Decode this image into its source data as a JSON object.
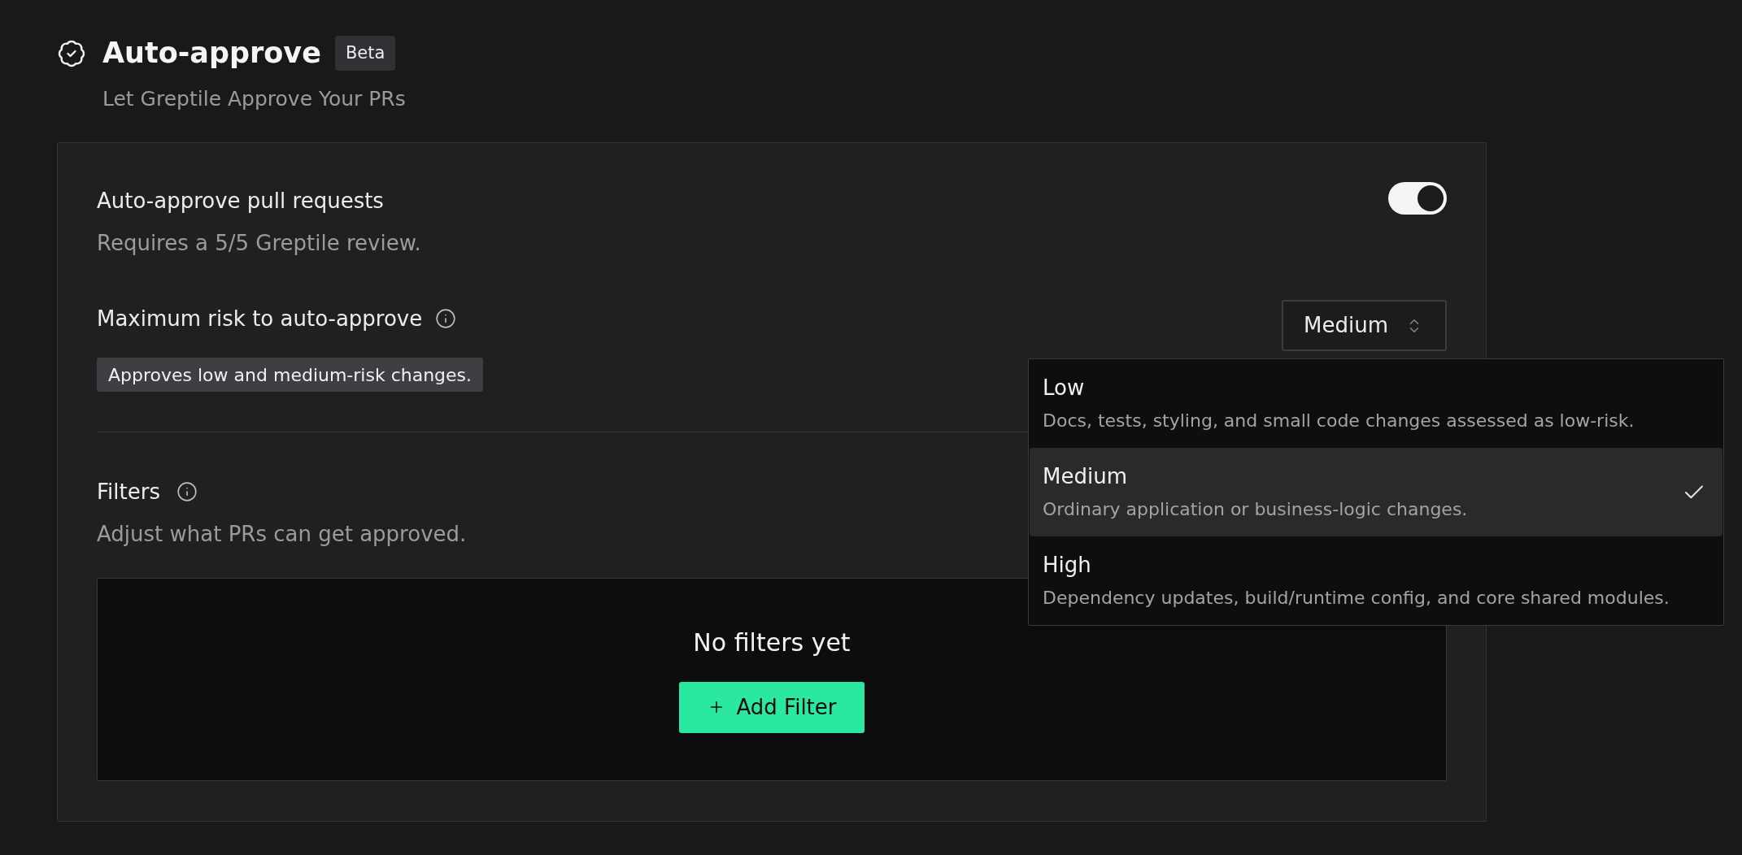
{
  "header": {
    "title": "Auto-approve",
    "badge": "Beta",
    "subtitle": "Let Greptile Approve Your PRs"
  },
  "auto_approve": {
    "label": "Auto-approve pull requests",
    "description": "Requires a 5/5 Greptile review.",
    "on": true
  },
  "max_risk": {
    "label": "Maximum risk to auto-approve",
    "select": {
      "value": "Medium",
      "expanded": true
    },
    "hint": "Approves low and medium-risk changes.",
    "options": [
      {
        "label": "Low",
        "description": "Docs, tests, styling, and small code changes assessed as low-risk.",
        "selected": false
      },
      {
        "label": "Medium",
        "description": "Ordinary application or business-logic changes.",
        "selected": true
      },
      {
        "label": "High",
        "description": "Dependency updates, build/runtime config, and core shared modules.",
        "selected": false
      }
    ]
  },
  "filters": {
    "label": "Filters",
    "description": "Adjust what PRs can get approved.",
    "empty_text": "No filters yet",
    "add_button": "Add Filter"
  }
}
